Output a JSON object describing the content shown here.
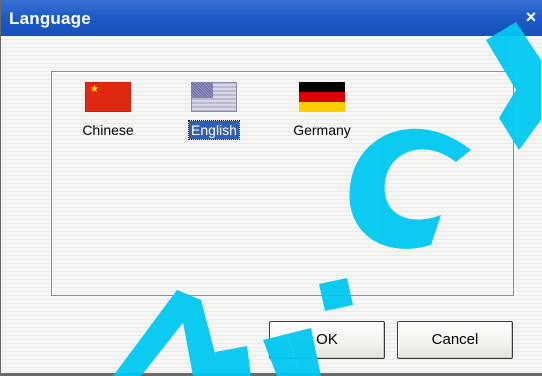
{
  "window": {
    "title": "Language",
    "close_glyph": "×"
  },
  "languages": [
    {
      "label": "Chinese",
      "flag": "china-flag",
      "selected": false
    },
    {
      "label": "English",
      "flag": "usa-flag",
      "selected": true
    },
    {
      "label": "Germany",
      "flag": "germany-flag",
      "selected": false
    }
  ],
  "buttons": {
    "ok_label": "OK",
    "cancel_label": "Cancel"
  },
  "colors": {
    "titlebar": "#1f5bc6",
    "selection": "#2f5fb3",
    "watermark": "#00c8f0"
  }
}
